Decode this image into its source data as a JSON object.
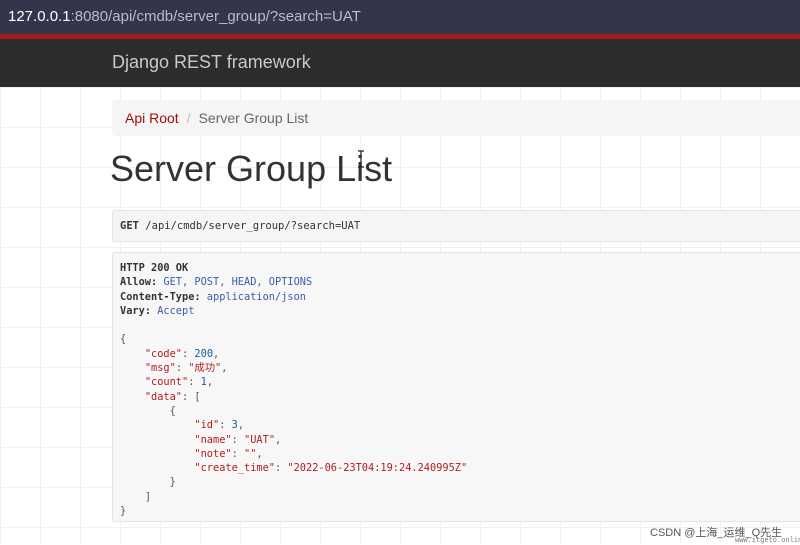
{
  "browser": {
    "url_host": "127.0.0.1",
    "url_rest": ":8080/api/cmdb/server_group/?search=UAT"
  },
  "navbar": {
    "brand": "Django REST framework"
  },
  "breadcrumb": {
    "root": "Api Root",
    "separator": "/",
    "current": "Server Group List"
  },
  "page": {
    "title": "Server Group List"
  },
  "request": {
    "method": "GET",
    "path": "/api/cmdb/server_group/?search=UAT"
  },
  "response": {
    "status": "HTTP 200 OK",
    "headers": [
      {
        "key": "Allow:",
        "value": "GET, POST, HEAD, OPTIONS"
      },
      {
        "key": "Content-Type:",
        "value": "application/json"
      },
      {
        "key": "Vary:",
        "value": "Accept"
      }
    ],
    "body": {
      "open_brace": "{",
      "close_brace": "}",
      "code_key": "\"code\"",
      "code_value": "200",
      "msg_key": "\"msg\"",
      "msg_value": "\"成功\"",
      "count_key": "\"count\"",
      "count_value": "1",
      "data_key": "\"data\"",
      "data_open": "[",
      "data_close": "]",
      "item_open": "{",
      "item_close": "}",
      "id_key": "\"id\"",
      "id_value": "3",
      "name_key": "\"name\"",
      "name_value": "\"UAT\"",
      "note_key": "\"note\"",
      "note_value": "\"\"",
      "create_time_key": "\"create_time\"",
      "create_time_value": "\"2022-06-23T04:19:24.240995Z\""
    }
  },
  "watermark": {
    "text": "CSDN @上海_运维_Q先生",
    "site": "www.itgeto.online"
  },
  "colors": {
    "navbar_bg": "#2c2c2c",
    "navbar_accent": "#a51c1c",
    "link": "#a30d0d",
    "json_key": "#b01e1e",
    "json_number": "#1a5aa8"
  }
}
